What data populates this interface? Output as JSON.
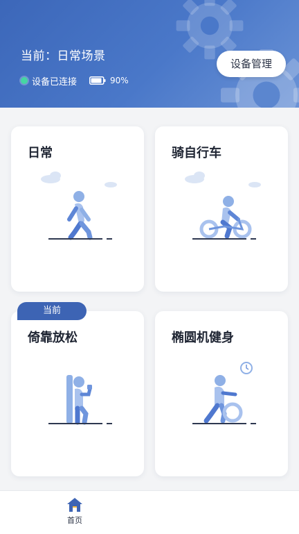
{
  "header": {
    "scene_title": "当前：日常场景",
    "connection_status": "设备已连接",
    "battery_level": "90%",
    "device_button": "设备管理"
  },
  "cards": [
    {
      "title": "日常",
      "illustration": "walking-person-icon",
      "current": false
    },
    {
      "title": "骑自行车",
      "illustration": "cycling-person-icon",
      "current": false
    },
    {
      "title": "倚靠放松",
      "illustration": "leaning-person-icon",
      "current": true
    },
    {
      "title": "椭圆机健身",
      "illustration": "elliptical-person-icon",
      "current": false
    }
  ],
  "current_badge": "当前",
  "nav": {
    "home_label": "首页"
  },
  "colors": {
    "header_blue": "#3c67b9",
    "accent_blue": "#3d64b4",
    "connected_green": "#45d6a2"
  }
}
